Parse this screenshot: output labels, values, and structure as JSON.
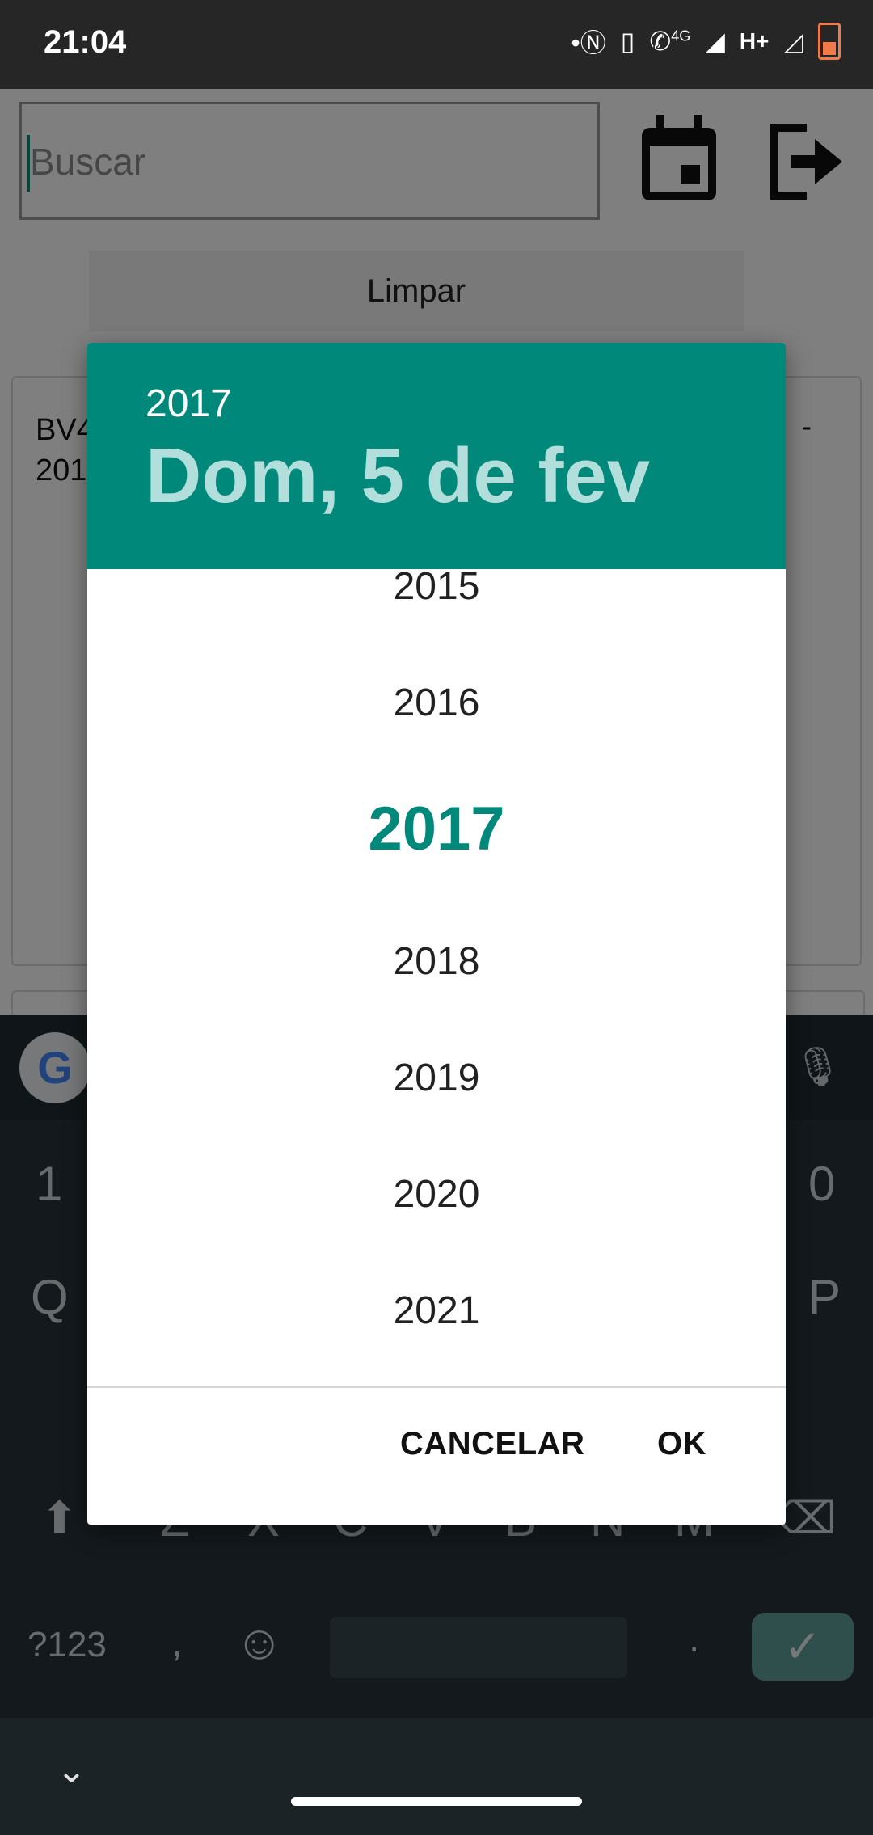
{
  "status_bar": {
    "time": "21:04",
    "icons": [
      "nfc-icon",
      "vibrate-icon",
      "call-4g-icon",
      "signal-icon",
      "h-plus-icon",
      "signal-empty-icon",
      "battery-low-icon"
    ],
    "network_label": "H+",
    "call_label": "4G"
  },
  "app": {
    "search_placeholder": "Buscar",
    "calendar_icon": "calendar-icon",
    "exit_icon": "exit-icon",
    "clear_label": "Limpar",
    "card_text_line1": "BV4",
    "card_text_line2": "201",
    "card_text_right": "-"
  },
  "dialog": {
    "header_year": "2017",
    "header_date": "Dom, 5 de fev",
    "years": [
      "2015",
      "2016",
      "2017",
      "2018",
      "2019",
      "2020",
      "2021"
    ],
    "selected_year": "2017",
    "cancel_label": "CANCELAR",
    "ok_label": "OK",
    "accent_color": "#00897b"
  },
  "keyboard": {
    "row_numbers_visible": [
      "1",
      "0"
    ],
    "row_top_visible": [
      "Q",
      "P"
    ],
    "row_bottom_visible": [
      "Z",
      "X",
      "C",
      "V",
      "B",
      "N",
      "M"
    ],
    "symbols_key": "?123",
    "comma_key": ",",
    "period_key": ".",
    "google_label": "G"
  }
}
